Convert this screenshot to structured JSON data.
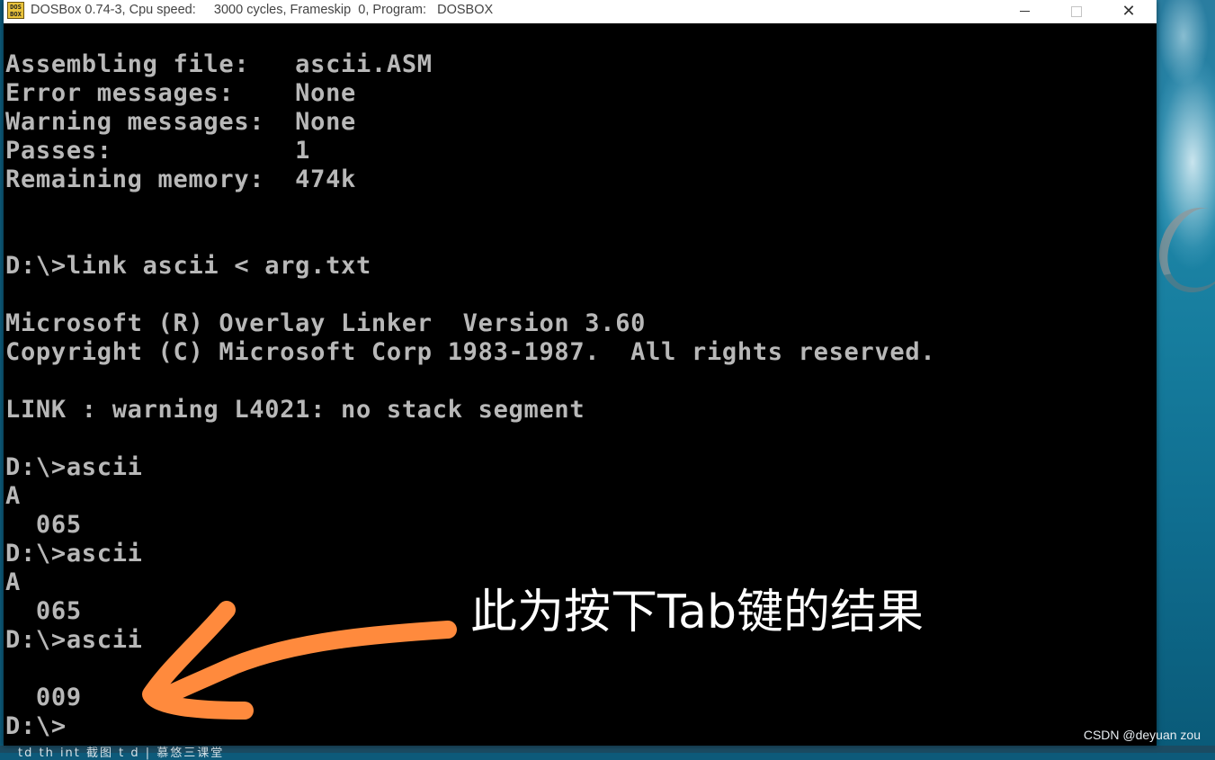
{
  "window": {
    "title": "DOSBox 0.74-3, Cpu speed:     3000 cycles, Frameskip  0, Program:   DOSBOX",
    "icon_label": "DOS BOX",
    "buttons": [
      "minimize-icon",
      "maximize-icon",
      "close-icon"
    ]
  },
  "console": {
    "lines": [
      "Assembling file:   ascii.ASM",
      "Error messages:    None",
      "Warning messages:  None",
      "Passes:            1",
      "Remaining memory:  474k",
      "",
      "",
      "D:\\>link ascii < arg.txt",
      "",
      "Microsoft (R) Overlay Linker  Version 3.60",
      "Copyright (C) Microsoft Corp 1983-1987.  All rights reserved.",
      "",
      "LINK : warning L4021: no stack segment",
      "",
      "D:\\>ascii",
      "A",
      "  065",
      "D:\\>ascii",
      "A",
      "  065",
      "D:\\>ascii",
      "",
      "  009",
      "D:\\>"
    ]
  },
  "annotation": {
    "text": "此为按下Tab键的结果",
    "arrow_color": "#ff8a3d"
  },
  "watermark": "CSDN @deyuan zou",
  "taskbar_text": "  td        th         int         截图       t    d     | 慕悠三课堂"
}
